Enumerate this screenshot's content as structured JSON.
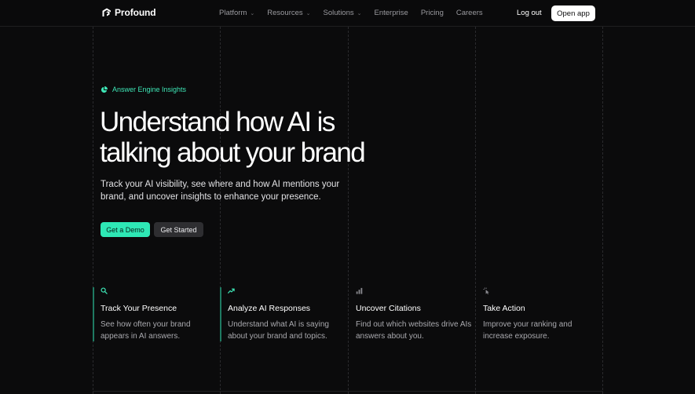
{
  "brand": {
    "name": "Profound"
  },
  "nav": {
    "items": [
      {
        "label": "Platform",
        "has_dropdown": true
      },
      {
        "label": "Resources",
        "has_dropdown": true
      },
      {
        "label": "Solutions",
        "has_dropdown": true
      },
      {
        "label": "Enterprise",
        "has_dropdown": false
      },
      {
        "label": "Pricing",
        "has_dropdown": false
      },
      {
        "label": "Careers",
        "has_dropdown": false
      }
    ],
    "logout_label": "Log out",
    "open_app_label": "Open app"
  },
  "hero": {
    "badge_label": "Answer Engine Insights",
    "headline": "Understand how AI is talking about your brand",
    "subtitle": "Track your AI visibility, see where and how AI mentions your brand, and uncover insights to enhance your presence.",
    "primary_cta": "Get a Demo",
    "secondary_cta": "Get Started"
  },
  "features": [
    {
      "icon": "search-icon",
      "title": "Track Your Presence",
      "description": "See how often your brand appears in AI answers.",
      "active": true
    },
    {
      "icon": "trend-up-icon",
      "title": "Analyze AI Responses",
      "description": "Understand what AI is saying about your brand and topics.",
      "active": true
    },
    {
      "icon": "bar-chart-icon",
      "title": "Uncover Citations",
      "description": "Find out which websites drive AIs answers about you.",
      "active": false
    },
    {
      "icon": "cursor-click-icon",
      "title": "Take Action",
      "description": "Improve your ranking and increase exposure.",
      "active": false
    }
  ],
  "colors": {
    "background": "#0b0b0c",
    "accent": "#2ee8b5",
    "accent_text": "#3ee6b6",
    "muted_text": "#a9a9ae",
    "secondary_button": "#2e2e31"
  }
}
